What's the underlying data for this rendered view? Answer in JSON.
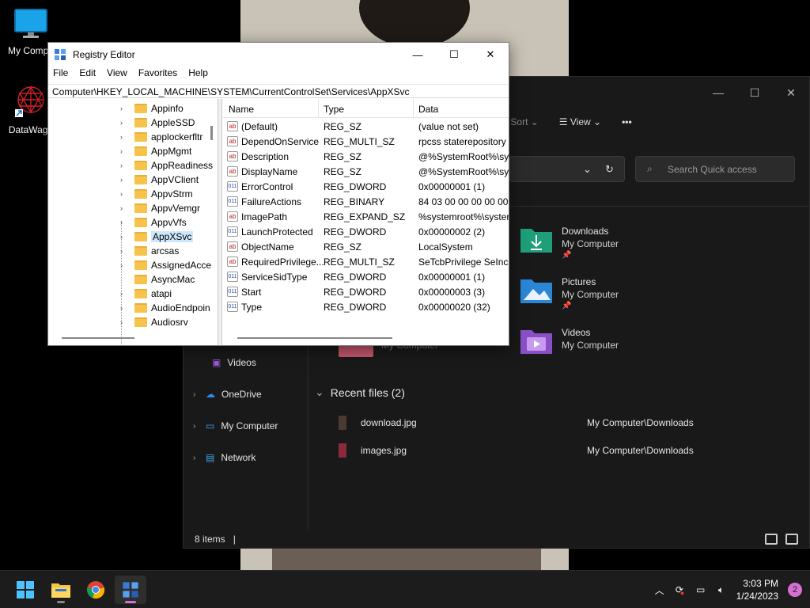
{
  "desktop": {
    "icons": [
      {
        "label": "My Compu",
        "icon": "monitor-icon"
      },
      {
        "label": "DataWago",
        "icon": "datawagon-shortcut-icon"
      }
    ]
  },
  "explorer": {
    "toolbar": {
      "sort_label": "Sort",
      "view_label": "View",
      "more_label": "•••"
    },
    "search_placeholder": "Search Quick access",
    "nav": [
      {
        "label": "Videos",
        "icon": "videos-folder-icon"
      },
      {
        "label": "OneDrive",
        "icon": "onedrive-icon"
      },
      {
        "label": "My Computer",
        "icon": "computer-icon"
      },
      {
        "label": "Network",
        "icon": "network-icon"
      }
    ],
    "quick_access": [
      {
        "name": "Downloads",
        "location": "My Computer",
        "pinned": true,
        "icon": "downloads-folder-icon"
      },
      {
        "name": "Pictures",
        "location": "My Computer",
        "pinned": true,
        "icon": "pictures-folder-icon"
      },
      {
        "name": "Videos",
        "location": "My Computer",
        "pinned": false,
        "icon": "videos-folder-icon"
      }
    ],
    "partial_item_location": "My Computer",
    "recent_header": "Recent files (2)",
    "recent_files": [
      {
        "name": "download.jpg",
        "path": "My Computer\\Downloads"
      },
      {
        "name": "images.jpg",
        "path": "My Computer\\Downloads"
      }
    ],
    "status": "8 items",
    "status_sep": "|"
  },
  "regedit": {
    "title": "Registry Editor",
    "menu": [
      "File",
      "Edit",
      "View",
      "Favorites",
      "Help"
    ],
    "address": "Computer\\HKEY_LOCAL_MACHINE\\SYSTEM\\CurrentControlSet\\Services\\AppXSvc",
    "tree": [
      {
        "label": "Appinfo",
        "expandable": true
      },
      {
        "label": "AppleSSD",
        "expandable": true
      },
      {
        "label": "applockerfltr",
        "expandable": true
      },
      {
        "label": "AppMgmt",
        "expandable": true
      },
      {
        "label": "AppReadiness",
        "expandable": true
      },
      {
        "label": "AppVClient",
        "expandable": true
      },
      {
        "label": "AppvStrm",
        "expandable": true
      },
      {
        "label": "AppvVemgr",
        "expandable": true
      },
      {
        "label": "AppvVfs",
        "expandable": true
      },
      {
        "label": "AppXSvc",
        "expandable": true,
        "selected": true
      },
      {
        "label": "arcsas",
        "expandable": true
      },
      {
        "label": "AssignedAcce",
        "expandable": true
      },
      {
        "label": "AsyncMac",
        "expandable": false
      },
      {
        "label": "atapi",
        "expandable": true
      },
      {
        "label": "AudioEndpoin",
        "expandable": true
      },
      {
        "label": "Audiosrv",
        "expandable": true
      }
    ],
    "columns": {
      "name": "Name",
      "type": "Type",
      "data": "Data"
    },
    "values": [
      {
        "name": "(Default)",
        "type": "REG_SZ",
        "data": "(value not set)",
        "kind": "ab"
      },
      {
        "name": "DependOnService",
        "type": "REG_MULTI_SZ",
        "data": "rpcss staterepository",
        "kind": "ab"
      },
      {
        "name": "Description",
        "type": "REG_SZ",
        "data": "@%SystemRoot%\\sys",
        "kind": "ab"
      },
      {
        "name": "DisplayName",
        "type": "REG_SZ",
        "data": "@%SystemRoot%\\sys",
        "kind": "ab"
      },
      {
        "name": "ErrorControl",
        "type": "REG_DWORD",
        "data": "0x00000001 (1)",
        "kind": "bin"
      },
      {
        "name": "FailureActions",
        "type": "REG_BINARY",
        "data": "84 03 00 00 00 00 00 00",
        "kind": "bin"
      },
      {
        "name": "ImagePath",
        "type": "REG_EXPAND_SZ",
        "data": "%systemroot%\\syster",
        "kind": "ab"
      },
      {
        "name": "LaunchProtected",
        "type": "REG_DWORD",
        "data": "0x00000002 (2)",
        "kind": "bin"
      },
      {
        "name": "ObjectName",
        "type": "REG_SZ",
        "data": "LocalSystem",
        "kind": "ab"
      },
      {
        "name": "RequiredPrivilege...",
        "type": "REG_MULTI_SZ",
        "data": "SeTcbPrivilege SeIncre",
        "kind": "ab"
      },
      {
        "name": "ServiceSidType",
        "type": "REG_DWORD",
        "data": "0x00000001 (1)",
        "kind": "bin"
      },
      {
        "name": "Start",
        "type": "REG_DWORD",
        "data": "0x00000003 (3)",
        "kind": "bin"
      },
      {
        "name": "Type",
        "type": "REG_DWORD",
        "data": "0x00000020 (32)",
        "kind": "bin"
      }
    ]
  },
  "taskbar": {
    "apps": [
      {
        "name": "start",
        "icon": "windows-start-icon"
      },
      {
        "name": "file-explorer",
        "icon": "file-explorer-icon"
      },
      {
        "name": "chrome",
        "icon": "chrome-icon"
      },
      {
        "name": "registry-editor",
        "icon": "regedit-icon",
        "active": true
      }
    ],
    "time": "3:03 PM",
    "date": "1/24/2023",
    "notifications": "2"
  },
  "colors": {
    "accent": "#d56fd3",
    "selection": "#cce8ff",
    "folder": "#f7c34b",
    "explorer_bg": "#191919"
  }
}
